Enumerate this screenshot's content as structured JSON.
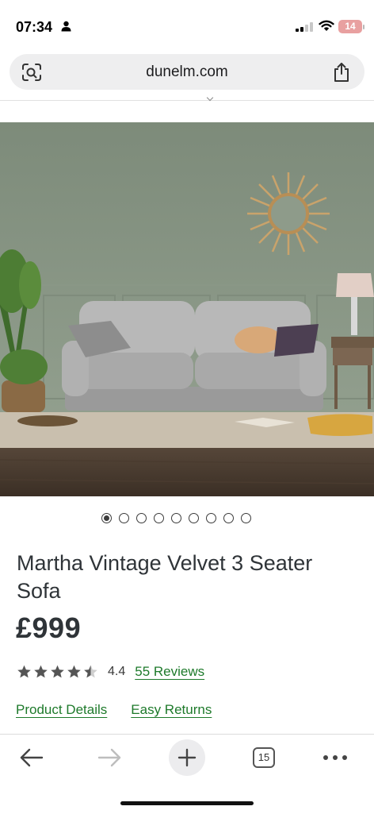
{
  "status_bar": {
    "time": "07:34",
    "battery": "14"
  },
  "browser": {
    "url": "dunelm.com",
    "tab_count": "15"
  },
  "product": {
    "title": "Martha Vintage Velvet 3 Seater Sofa",
    "price": "£999",
    "rating": "4.4",
    "reviews_link": "55 Reviews",
    "image_count": 9,
    "active_image": 1
  },
  "links": {
    "details": "Product Details",
    "returns": "Easy Returns"
  },
  "icons": [
    "person-icon",
    "cellular-signal-icon",
    "wifi-icon",
    "battery-icon",
    "lens-icon",
    "share-icon",
    "back-icon",
    "forward-icon",
    "new-tab-icon",
    "tabs-icon",
    "more-icon",
    "star-icon"
  ],
  "colors": {
    "link": "#1e7a2b",
    "text": "#2f3438",
    "wall": "#8e9c8a"
  }
}
